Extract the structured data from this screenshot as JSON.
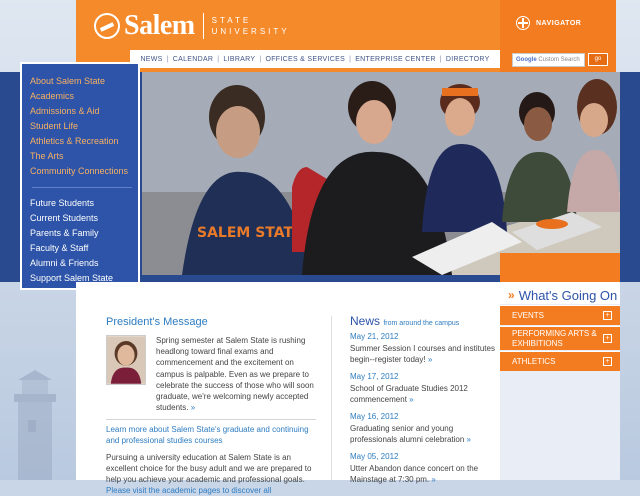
{
  "logo": {
    "word": "Salem",
    "sub_line1": "STATE",
    "sub_line2": "UNIVERSITY"
  },
  "topnav": [
    "NEWS",
    "CALENDAR",
    "LIBRARY",
    "OFFICES & SERVICES",
    "ENTERPRISE CENTER",
    "DIRECTORY"
  ],
  "navigator": {
    "label": "NAVIGATOR"
  },
  "search": {
    "google": "Google",
    "placeholder": "Custom Search",
    "go_label": "go"
  },
  "leftnav": {
    "primary": [
      "About Salem State",
      "Academics",
      "Admissions & Aid",
      "Student Life",
      "Athletics & Recreation",
      "The Arts",
      "Community Connections"
    ],
    "secondary": [
      "Future Students",
      "Current Students",
      "Parents & Family",
      "Faculty & Staff",
      "Alumni & Friends",
      "Support Salem State"
    ]
  },
  "whats_going_on": {
    "title": "What's Going On",
    "items": [
      {
        "label": "EVENTS"
      },
      {
        "label": "PERFORMING ARTS & EXHIBITIONS"
      },
      {
        "label": "ATHLETICS"
      }
    ]
  },
  "presidents_message": {
    "title": "President's Message",
    "text": "Spring semester at Salem State is rushing headlong toward final exams and commencement and the excitement on campus is palpable. Even as we prepare to celebrate the success of those who will soon graduate, we're welcoming newly accepted students.",
    "more": "»"
  },
  "graduate": {
    "title": "Learn more about Salem State's graduate and continuing and professional studies courses",
    "text": "Pursuing a university education at Salem State is an excellent choice for the busy adult and we are prepared to help you achieve your academic and professional goals.",
    "link": "Please visit the academic pages to discover all"
  },
  "news": {
    "title": "News",
    "subtitle": "from around the campus",
    "items": [
      {
        "date": "May 21, 2012",
        "text": "Summer Session I courses and institutes begin--register today!"
      },
      {
        "date": "May 17, 2012",
        "text": "School of Graduate Studies 2012 commencement"
      },
      {
        "date": "May 16, 2012",
        "text": "Graduating senior and young professionals alumni celebration"
      },
      {
        "date": "May 05, 2012",
        "text": "Utter Abandon dance concert on the Mainstage at 7:30 pm."
      }
    ],
    "more": "»"
  },
  "colors": {
    "orange": "#f47c20",
    "blue": "#2d54a8",
    "link_blue": "#2d7cc1"
  }
}
